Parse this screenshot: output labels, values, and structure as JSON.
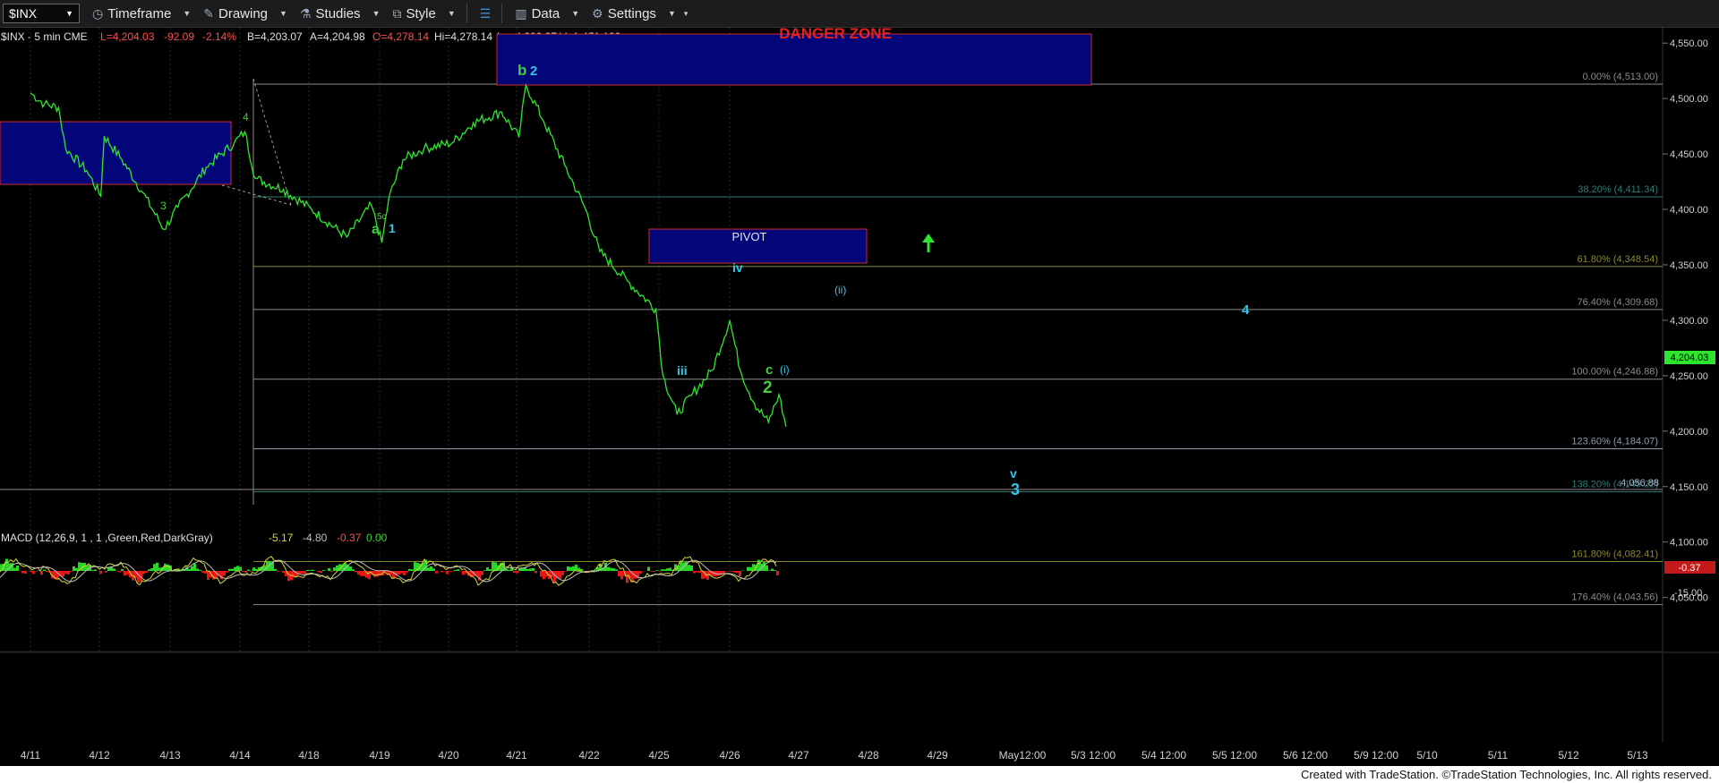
{
  "toolbar": {
    "symbol": "$INX",
    "timeframe": "Timeframe",
    "drawing": "Drawing",
    "studies": "Studies",
    "style": "Style",
    "data": "Data",
    "settings": "Settings"
  },
  "header": {
    "title": "$INX - 5 min  CME",
    "last": "L=4,204.03",
    "change": "-92.09",
    "pct": "-2.14%",
    "bid": "B=4,203.07",
    "ask": "A=4,204.98",
    "open": "O=4,278.14",
    "high": "Hi=4,278.14",
    "low": "Lo=4,200.37",
    "volume": "V=1,471,189"
  },
  "colors": {
    "price": "#2ee62e",
    "zone_fill": "#020678",
    "zone_border": "#d42a2a",
    "cyan": "#35c6e6",
    "green_label": "#3fcf3f",
    "macd_hist_pos": "#26d726",
    "macd_hist_neg": "#e81818",
    "macd_line": "#d6d63a",
    "signal_line": "#bfbfbf"
  },
  "macd": {
    "label": "MACD (12,26,9, 1 , 1 ,Green,Red,DarkGray)",
    "macd": "-5.17",
    "signal": "-4.80",
    "hist": "-0.37",
    "zero": "0.00",
    "axis_value": "-0.37",
    "axis_tick": "-15.00"
  },
  "zones": {
    "danger": "DANGER ZONE",
    "pivot": "PIVOT"
  },
  "last_price_label": "4,204.03",
  "ref_price_label": "4,056.88",
  "fib_levels": [
    {
      "label": "0.00% (4,513.00)",
      "price": 4513.0,
      "color": "#8c8c8c"
    },
    {
      "label": "38.20% (4,411.34)",
      "price": 4411.34,
      "color": "#2e7d74"
    },
    {
      "label": "61.80% (4,348.54)",
      "price": 4348.54,
      "color": "#8a8a2a"
    },
    {
      "label": "76.40% (4,309.68)",
      "price": 4309.68,
      "color": "#8c8c8c"
    },
    {
      "label": "100.00% (4,246.88)",
      "price": 4246.88,
      "color": "#8c8c8c"
    },
    {
      "label": "123.60% (4,184.07)",
      "price": 4184.07,
      "color": "#8c9cac"
    },
    {
      "label": "138.20% (4,145.22)",
      "price": 4145.22,
      "color": "#2e7d74"
    },
    {
      "label": "161.80% (4,082.41)",
      "price": 4082.41,
      "color": "#8a8a2a"
    },
    {
      "label": "176.40% (4,043.56)",
      "price": 4043.56,
      "color": "#8c8c8c"
    }
  ],
  "wave_labels": {
    "b": "b",
    "two_top": "2",
    "four_a": "4",
    "three_a": "3",
    "five_c": "5c",
    "a": "a",
    "one": "1",
    "iii": "iii",
    "iv": "iv",
    "ii": "(ii)",
    "c": "c",
    "i": "(i)",
    "two": "2",
    "four": "4",
    "v": "v",
    "three": "3"
  },
  "footer": "Created with TradeStation. ©TradeStation Technologies, Inc. All rights reserved.",
  "chart_data": {
    "type": "line",
    "title": "$INX - 5 min",
    "x": [
      "4/11",
      "4/12",
      "4/13",
      "4/14",
      "4/18",
      "4/19",
      "4/20",
      "4/21",
      "4/22",
      "4/25",
      "4/26",
      "4/27",
      "4/28",
      "4/29",
      "May12:00",
      "5/3 12:00",
      "5/4 12:00",
      "5/5 12:00",
      "5/6 12:00",
      "5/9 12:00",
      "5/10",
      "5/11",
      "5/12",
      "5/13"
    ],
    "y_ticks": [
      "4,550.00",
      "4,500.00",
      "4,450.00",
      "4,400.00",
      "4,350.00",
      "4,300.00",
      "4,250.00",
      "4,200.00",
      "4,150.00",
      "4,100.00",
      "4,050.00"
    ],
    "ylim": [
      4005,
      4560
    ],
    "series": [
      {
        "values": [
          [
            0,
            4505
          ],
          [
            0.2,
            4495
          ],
          [
            0.4,
            4492
          ],
          [
            0.5,
            4455
          ],
          [
            0.8,
            4435
          ],
          [
            1.0,
            4412
          ],
          [
            1.05,
            4466
          ],
          [
            1.3,
            4445
          ],
          [
            1.6,
            4415
          ],
          [
            1.9,
            4382
          ],
          [
            2.1,
            4402
          ],
          [
            2.5,
            4438
          ],
          [
            2.9,
            4460
          ],
          [
            3.05,
            4470
          ],
          [
            3.2,
            4428
          ],
          [
            3.6,
            4418
          ],
          [
            4.0,
            4400
          ],
          [
            4.5,
            4375
          ],
          [
            4.85,
            4404
          ],
          [
            5.0,
            4370
          ],
          [
            5.1,
            4410
          ],
          [
            5.3,
            4445
          ],
          [
            5.6,
            4455
          ],
          [
            6.0,
            4460
          ],
          [
            6.3,
            4478
          ],
          [
            6.7,
            4488
          ],
          [
            6.95,
            4465
          ],
          [
            7.05,
            4512
          ],
          [
            7.3,
            4480
          ],
          [
            7.6,
            4440
          ],
          [
            7.9,
            4400
          ],
          [
            8.1,
            4362
          ],
          [
            8.5,
            4335
          ],
          [
            8.9,
            4310
          ],
          [
            9.0,
            4250
          ],
          [
            9.2,
            4215
          ],
          [
            9.4,
            4232
          ],
          [
            9.7,
            4255
          ],
          [
            9.95,
            4300
          ],
          [
            10.1,
            4255
          ],
          [
            10.3,
            4225
          ],
          [
            10.5,
            4208
          ],
          [
            10.65,
            4233
          ],
          [
            10.75,
            4204
          ]
        ]
      }
    ]
  }
}
